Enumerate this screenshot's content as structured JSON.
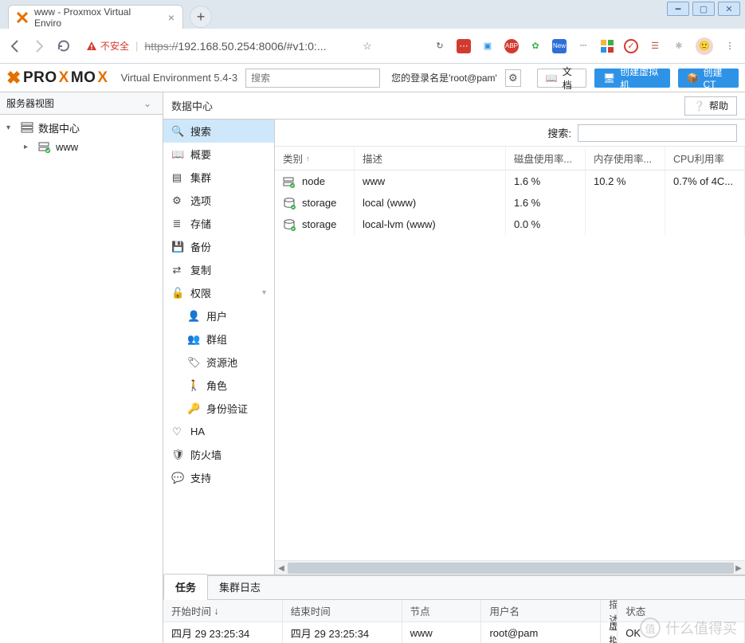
{
  "browser": {
    "tab_title": "www - Proxmox Virtual Enviro",
    "insecure_label": "不安全",
    "url_scheme": "https://",
    "url_rest": "192.168.50.254:8006/#v1:0:..."
  },
  "topbar": {
    "brand_pre": "PRO",
    "brand_x": "X",
    "brand_post": "MO",
    "brand_x2": "X",
    "version_label": "Virtual Environment 5.4-3",
    "search_placeholder": "搜索",
    "login_label": "您的登录名是'root@pam'",
    "docs_label": "文档",
    "create_vm_label": "创建虚拟机",
    "create_ct_label": "创建CT"
  },
  "left": {
    "view_label": "服务器视图",
    "root": "数据中心",
    "node": "www"
  },
  "crumb": {
    "title": "数据中心",
    "help": "帮助"
  },
  "panel": {
    "items": [
      {
        "icon": "search",
        "label": "搜索",
        "sel": true
      },
      {
        "icon": "book",
        "label": "概要"
      },
      {
        "icon": "list",
        "label": "集群"
      },
      {
        "icon": "gear",
        "label": "选项"
      },
      {
        "icon": "db",
        "label": "存储"
      },
      {
        "icon": "save",
        "label": "备份"
      },
      {
        "icon": "retweet",
        "label": "复制"
      },
      {
        "icon": "lock",
        "label": "权限",
        "expand": true
      },
      {
        "icon": "user",
        "label": "用户",
        "sub": true
      },
      {
        "icon": "users",
        "label": "群组",
        "sub": true
      },
      {
        "icon": "tag",
        "label": "资源池",
        "sub": true
      },
      {
        "icon": "male",
        "label": "角色",
        "sub": true
      },
      {
        "icon": "key",
        "label": "身份验证",
        "sub": true
      },
      {
        "icon": "heart",
        "label": "HA"
      },
      {
        "icon": "shield",
        "label": "防火墙"
      },
      {
        "icon": "comment",
        "label": "支持"
      }
    ]
  },
  "grid": {
    "search_label": "搜索:",
    "cols": {
      "type": "类别",
      "desc": "描述",
      "disk": "磁盘使用率...",
      "mem": "内存使用率...",
      "cpu": "CPU利用率"
    },
    "rows": [
      {
        "kind": "node",
        "type": "node",
        "desc": "www",
        "disk": "1.6 %",
        "mem": "10.2 %",
        "cpu": "0.7% of 4C..."
      },
      {
        "kind": "storage",
        "type": "storage",
        "desc": "local (www)",
        "disk": "1.6 %",
        "mem": "",
        "cpu": ""
      },
      {
        "kind": "storage",
        "type": "storage",
        "desc": "local-lvm (www)",
        "disk": "0.0 %",
        "mem": "",
        "cpu": ""
      }
    ]
  },
  "bottom": {
    "tabs": {
      "tasks": "任务",
      "cluster_log": "集群日志"
    },
    "cols": {
      "start": "开始时间",
      "end": "结束时间",
      "node": "节点",
      "user": "用户名",
      "desc": "描述",
      "status": "状态"
    },
    "sort_indicator": "↓",
    "rows": [
      {
        "start": "四月 29 23:25:34",
        "end": "四月 29 23:25:34",
        "node": "www",
        "user": "root@pam",
        "desc": "启动所有虚拟机和容器",
        "status": "OK"
      }
    ]
  },
  "watermark": {
    "brand": "值",
    "text": "什么值得买"
  }
}
